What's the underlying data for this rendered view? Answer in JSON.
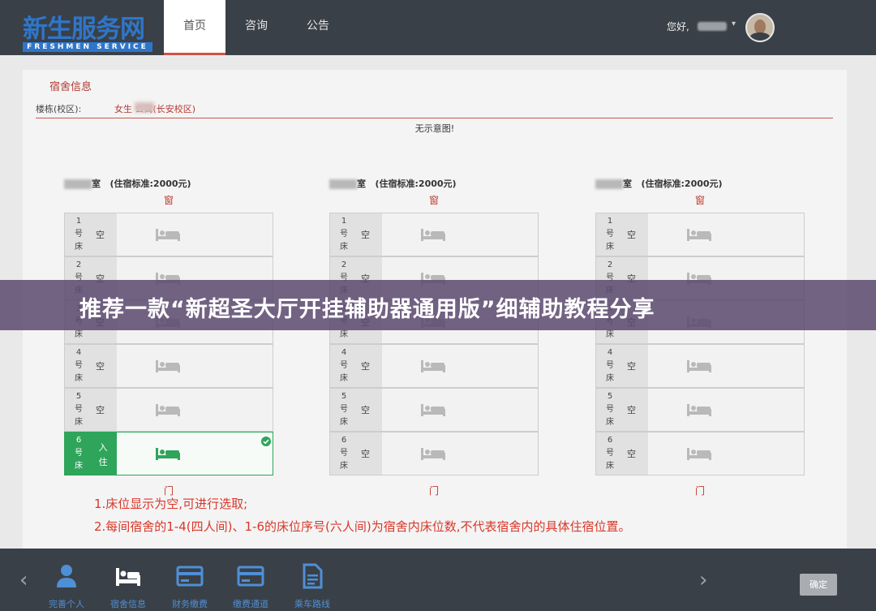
{
  "header": {
    "logo_cn": "新生服务网",
    "logo_en": "FRESHMEN SERVICE",
    "tabs": [
      {
        "label": "首页",
        "active": true
      },
      {
        "label": "咨询",
        "active": false
      },
      {
        "label": "公告",
        "active": false
      }
    ],
    "greeting": "您好,",
    "caret": "▾"
  },
  "dorm": {
    "section_title": "宿舍信息",
    "building_label": "楼栋(校区):",
    "building_value": "女生       公寓(长安校区)",
    "no_image": "无示意图!",
    "rooms": [
      {
        "suffix": "室",
        "standard": "(住宿标准:2000元)",
        "window": "窗",
        "door": "门",
        "beds": [
          {
            "no": "1号床",
            "status": "空",
            "occupied": false
          },
          {
            "no": "2号床",
            "status": "空",
            "occupied": false
          },
          {
            "no": "3号床",
            "status": "空",
            "occupied": false
          },
          {
            "no": "4号床",
            "status": "空",
            "occupied": false
          },
          {
            "no": "5号床",
            "status": "空",
            "occupied": false
          },
          {
            "no": "6号床",
            "status": "入住",
            "occupied": true
          }
        ]
      },
      {
        "suffix": "室",
        "standard": "(住宿标准:2000元)",
        "window": "窗",
        "door": "门",
        "beds": [
          {
            "no": "1号床",
            "status": "空",
            "occupied": false
          },
          {
            "no": "2号床",
            "status": "空",
            "occupied": false
          },
          {
            "no": "3号床",
            "status": "空",
            "occupied": false
          },
          {
            "no": "4号床",
            "status": "空",
            "occupied": false
          },
          {
            "no": "5号床",
            "status": "空",
            "occupied": false
          },
          {
            "no": "6号床",
            "status": "空",
            "occupied": false
          }
        ]
      },
      {
        "suffix": "室",
        "standard": "(住宿标准:2000元)",
        "window": "窗",
        "door": "门",
        "beds": [
          {
            "no": "1号床",
            "status": "空",
            "occupied": false
          },
          {
            "no": "2号床",
            "status": "空",
            "occupied": false
          },
          {
            "no": "3号床",
            "status": "空",
            "occupied": false
          },
          {
            "no": "4号床",
            "status": "空",
            "occupied": false
          },
          {
            "no": "5号床",
            "status": "空",
            "occupied": false
          },
          {
            "no": "6号床",
            "status": "空",
            "occupied": false
          }
        ]
      }
    ],
    "notes": [
      "1.床位显示为空,可进行选取;",
      "2.每间宿舍的1-4(四人间)、1-6的床位序号(六人间)为宿舍内床位数,不代表宿舍内的具体住宿位置。"
    ]
  },
  "banner": {
    "text": "推荐一款“新超圣大厅开挂辅助器通用版”细辅助教程分享"
  },
  "footer": {
    "prev": "‹",
    "next": "›",
    "tools": [
      {
        "label": "完善个人",
        "icon": "person-icon"
      },
      {
        "label": "宿舍信息",
        "icon": "bed-icon"
      },
      {
        "label": "财务缴费",
        "icon": "card-icon"
      },
      {
        "label": "缴费通道",
        "icon": "card-icon"
      },
      {
        "label": "乘车路线",
        "icon": "document-icon"
      }
    ],
    "confirm": "确定"
  },
  "colors": {
    "accent_red": "#c0392b",
    "occupied_green": "#2ea55a",
    "header_bg": "#3a4047",
    "banner_bg": "#5c4a70",
    "link_blue": "#4f8fd6"
  }
}
